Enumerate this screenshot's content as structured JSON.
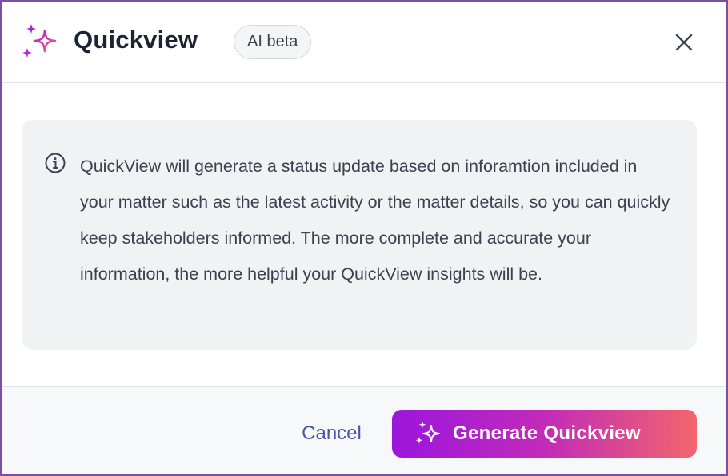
{
  "header": {
    "title": "Quickview",
    "badge": "AI beta",
    "close_icon": "close-icon"
  },
  "info": {
    "icon": "info-icon",
    "text": "QuickView will generate a status update based on inforamtion included in your matter such as the latest activity or the matter details, so you can quickly keep stakeholders informed. The more complete and accurate your information, the more helpful your QuickView insights will be."
  },
  "footer": {
    "cancel_label": "Cancel",
    "generate_label": "Generate Quickview"
  },
  "colors": {
    "border": "#7b4fa3",
    "title": "#1c2434",
    "cancel": "#4a55a8",
    "gradient_start": "#9b16dd",
    "gradient_end": "#f2656c"
  }
}
